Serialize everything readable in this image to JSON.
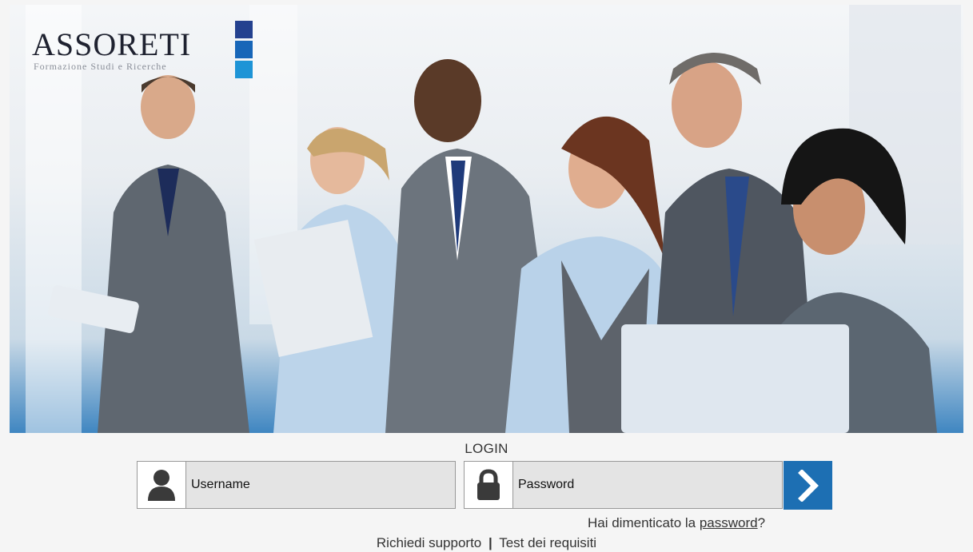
{
  "brand": {
    "name": "ASSORETI",
    "tagline": "Formazione Studi e Ricerche",
    "colors": [
      "#24418f",
      "#1766b8",
      "#1e94d6"
    ]
  },
  "hero": {
    "description_icon": "business-people-photo"
  },
  "login": {
    "title": "LOGIN",
    "username": {
      "placeholder": "Username",
      "value": "",
      "icon": "user-icon"
    },
    "password": {
      "placeholder": "Password",
      "value": "",
      "icon": "lock-icon"
    },
    "submit_icon": "chevron-right-icon",
    "accent": "#1d6fb3",
    "forgot_prefix": "Hai dimenticato la ",
    "forgot_link": "password",
    "forgot_suffix": "?"
  },
  "footer": {
    "support": "Richiedi supporto",
    "separator": "|",
    "requirements": "Test dei requisiti"
  }
}
